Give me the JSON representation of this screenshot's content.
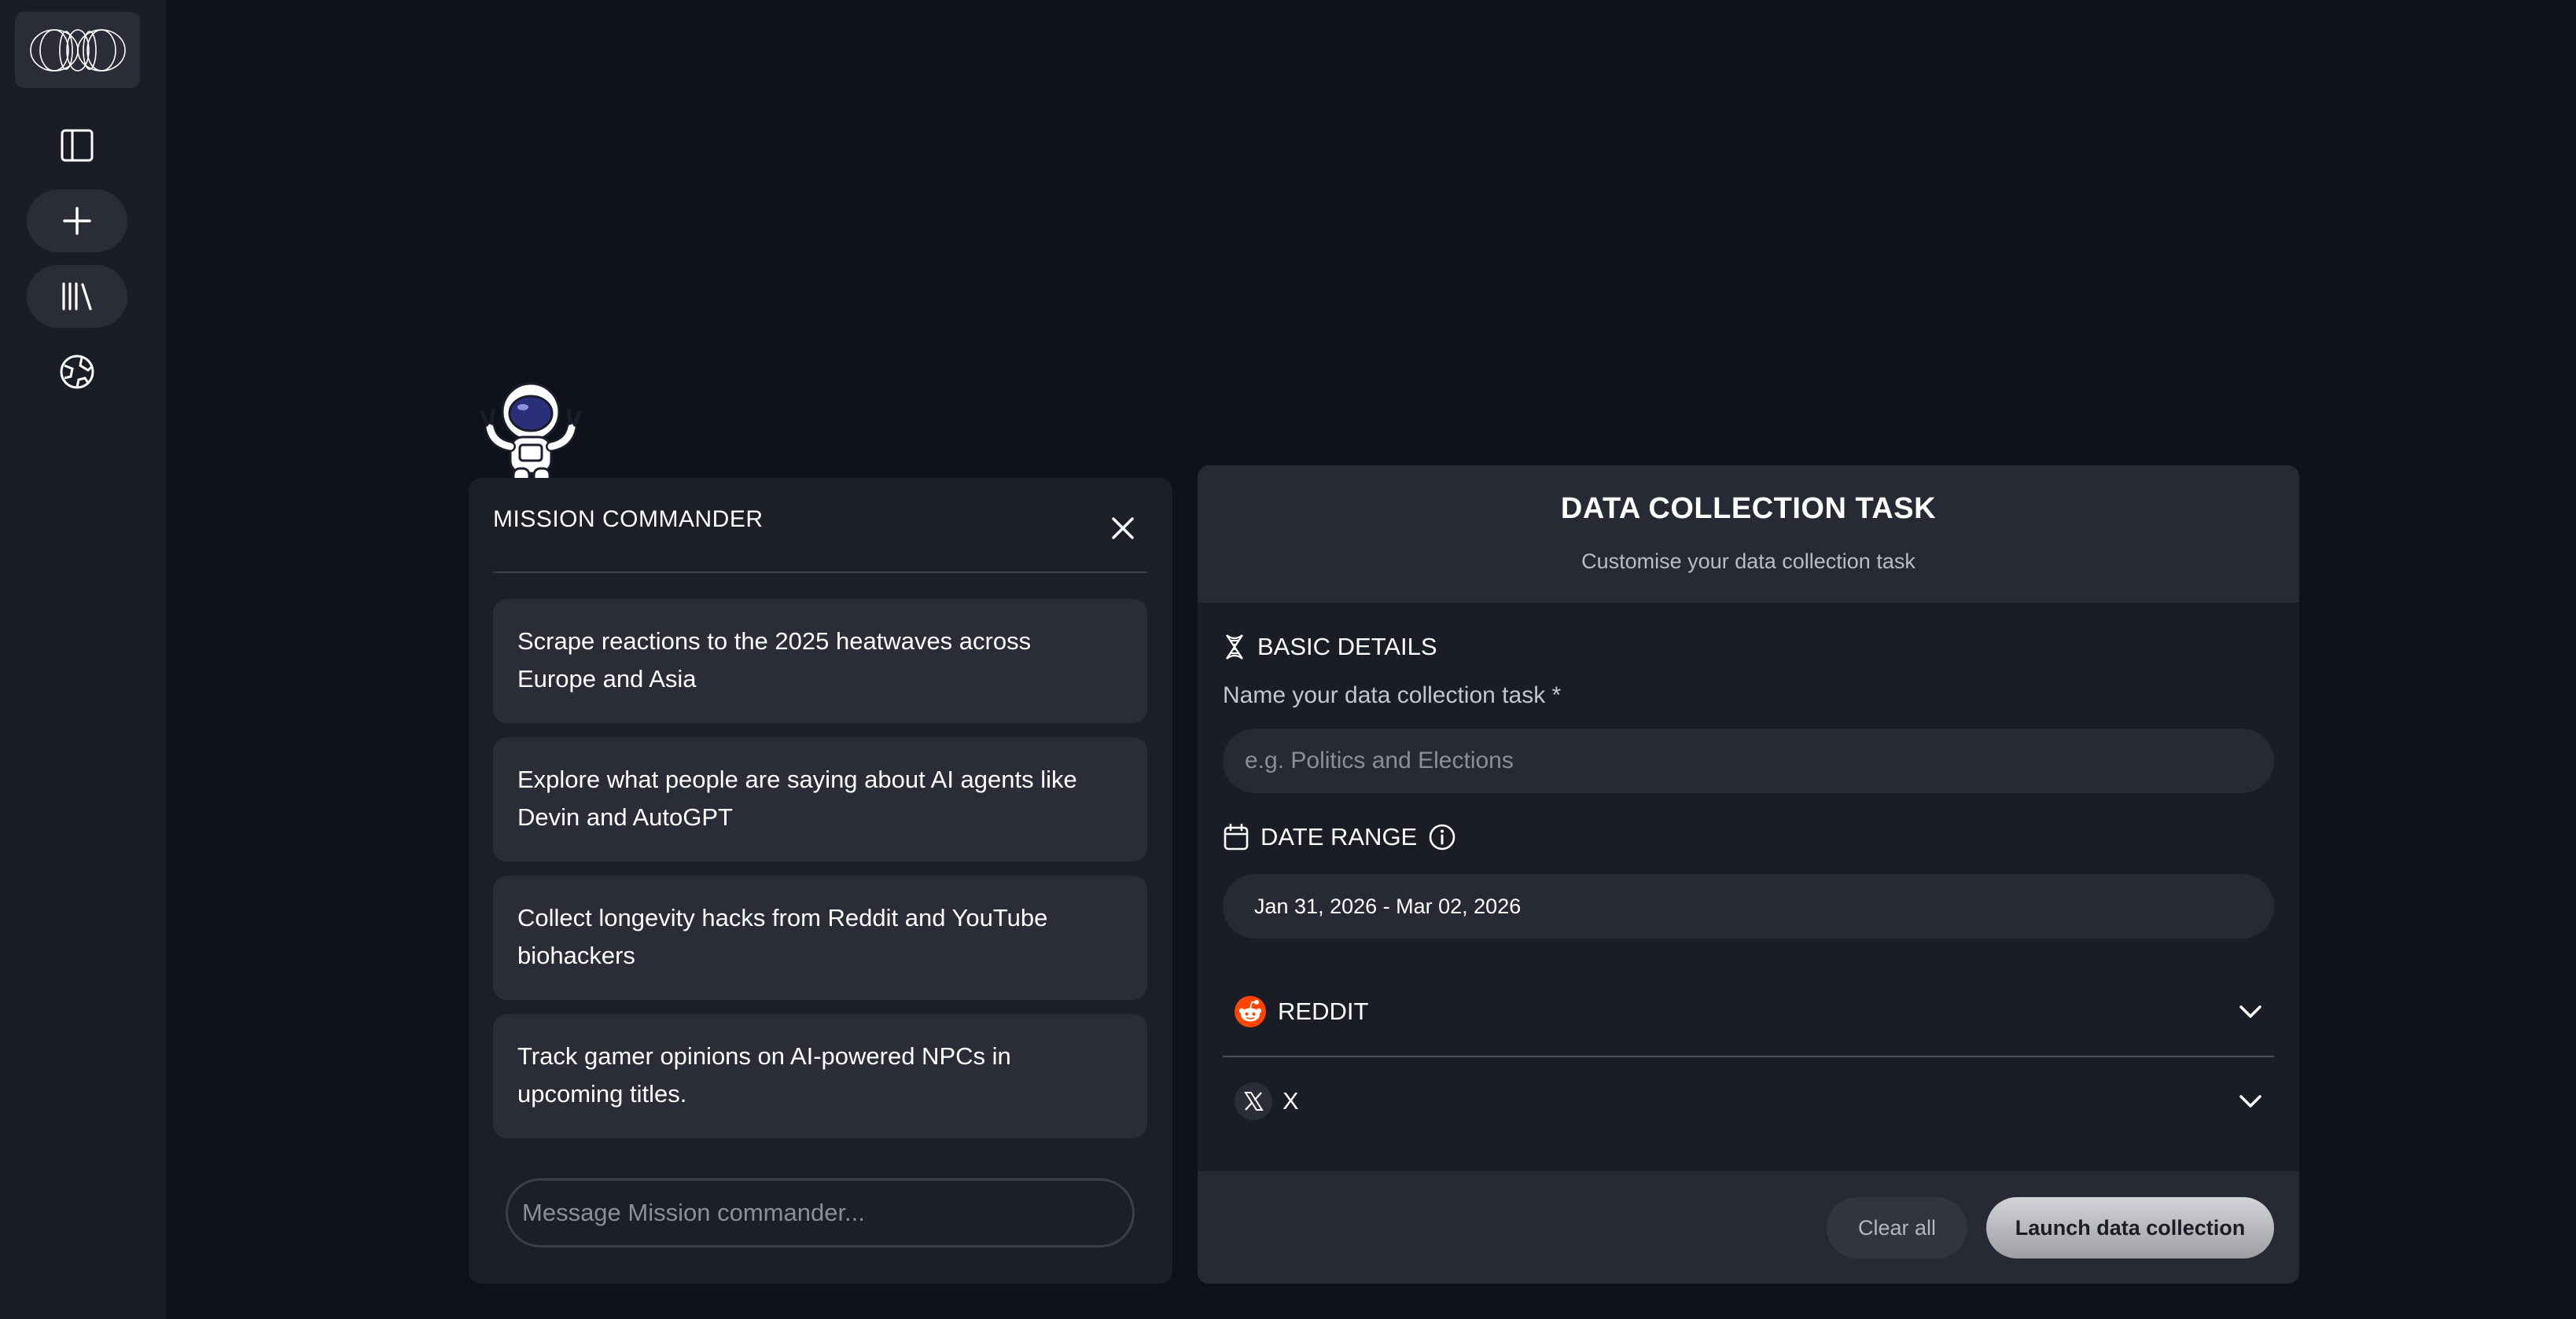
{
  "sidebar": {
    "logo_icon": "infinity-orbits-logo",
    "items": [
      {
        "icon": "sidebar-toggle-icon"
      },
      {
        "icon": "plus-icon"
      },
      {
        "icon": "library-icon"
      },
      {
        "icon": "globe-icon"
      }
    ]
  },
  "mission_commander": {
    "title": "MISSION COMMANDER",
    "suggestions": [
      {
        "line1": "Scrape reactions to the 2025 heatwaves across",
        "line2": "Europe and Asia"
      },
      {
        "line1": "Explore what people are saying about AI agents like",
        "line2": "Devin and AutoGPT"
      },
      {
        "line1": "Collect longevity hacks from Reddit and YouTube",
        "line2": "biohackers"
      },
      {
        "line1": "Track gamer opinions on AI-powered NPCs in",
        "line2": "upcoming titles."
      }
    ],
    "input_placeholder": "Message Mission commander..."
  },
  "data_collection": {
    "title": "DATA COLLECTION TASK",
    "subtitle": "Customise your data collection task",
    "basic_details_label": "BASIC DETAILS",
    "name_label": "Name your data collection task *",
    "name_placeholder": "e.g. Politics and Elections",
    "date_range_label": "DATE RANGE",
    "date_range_value": "Jan 31, 2026 - Mar 02, 2026",
    "platforms": [
      {
        "name": "REDDIT",
        "icon": "reddit-icon"
      },
      {
        "name": "X",
        "icon": "x-icon"
      }
    ],
    "clear_label": "Clear all",
    "launch_label": "Launch data collection"
  },
  "colors": {
    "background": "#0f121b",
    "panel": "#1c1f28",
    "card": "#2a2d37",
    "reddit_orange": "#ff4500"
  }
}
